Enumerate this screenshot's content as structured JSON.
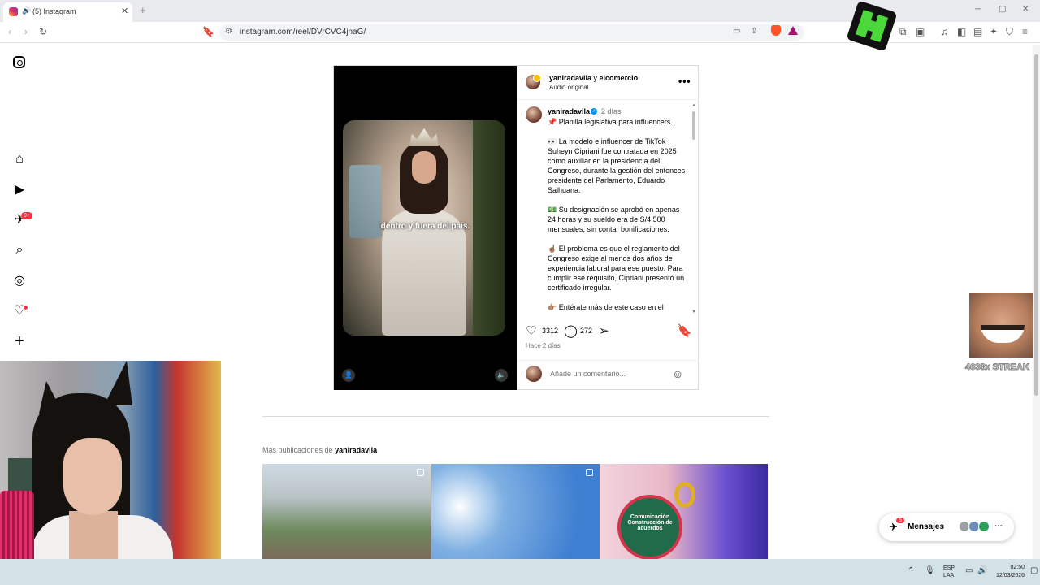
{
  "browser": {
    "tab_title": "(5) Instagram",
    "new_tab_symbol": "+",
    "url": "instagram.com/reel/DVrCVC4jnaG/"
  },
  "sidebar": {
    "notifications_badge": "9+"
  },
  "post": {
    "header": {
      "author": "yaniradavila",
      "joiner": " y ",
      "coauthor": "elcomercio",
      "audio": "Audio original"
    },
    "video_caption": "dentro y fuera del país.",
    "caption": {
      "author": "yaniradavila",
      "time": "2 días",
      "text": "📌 Planilla legislativa para influencers.\n\n👀 La modelo e influencer de TikTok Suheyn Cipriani fue contratada en 2025 como auxiliar en la presidencia del Congreso, durante la gestión del entonces presidente del Parlamento, Eduardo Salhuana.\n\n💵 Su designación se aprobó en apenas 24 horas y su sueldo era de S/4.500 mensuales, sin contar bonificaciones.\n\n☝🏽 El problema es que el reglamento del Congreso exige al menos dos años de experiencia laboral para ese puesto. Para cumplir ese requisito, Cipriani presentó un certificado irregular.\n\n👉🏽 Entérate más de este caso en el"
    },
    "likes": "3312",
    "comments": "272",
    "time_ago": "Hace 2 días",
    "comment_placeholder": "Añade un comentario..."
  },
  "more_posts": {
    "title": "Más publicaciones de ",
    "author": "yaniradavila",
    "sign_text": "Comunicación Construcción de acuerdos"
  },
  "messages": {
    "label": "Mensajes",
    "badge": "5"
  },
  "overlay": {
    "streak": "4638x STREAK"
  },
  "taskbar": {
    "lang_line1": "ESP",
    "lang_line2": "LAA",
    "time": "02:50",
    "date": "12/03/2026"
  },
  "colors": {
    "accent_badge": "#ff3040",
    "link_blue": "#0095f6"
  }
}
